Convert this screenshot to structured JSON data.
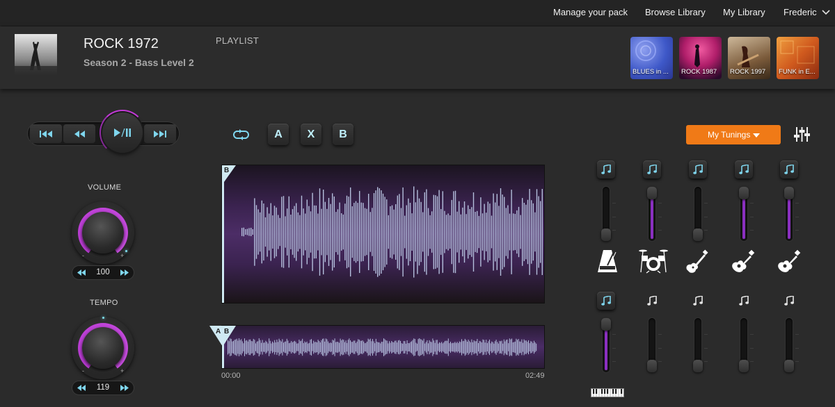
{
  "nav": {
    "manage_pack": "Manage your pack",
    "browse_library": "Browse Library",
    "my_library": "My Library",
    "user": "Frederic"
  },
  "track": {
    "title": "ROCK 1972",
    "subtitle": "Season 2 - Bass Level 2"
  },
  "playlist": {
    "label": "PLAYLIST",
    "items": [
      {
        "label": "BLUES in ...",
        "color": "#3e58c8"
      },
      {
        "label": "ROCK 1987",
        "color": "#b01e6a"
      },
      {
        "label": "ROCK 1997",
        "color": "#7a5a3a"
      },
      {
        "label": "FUNK in E...",
        "color": "#d05a1e"
      }
    ]
  },
  "transport": {
    "buttons": [
      "skip-back-icon",
      "rewind-icon",
      "play-pause-icon",
      "skip-forward-icon"
    ]
  },
  "volume": {
    "label": "VOLUME",
    "value": "100",
    "minus": "-",
    "plus": "+"
  },
  "tempo": {
    "label": "TEMPO",
    "value": "119",
    "minus": "-",
    "plus": "+"
  },
  "loop_controls": {
    "a": "A",
    "x": "X",
    "b": "B"
  },
  "waveform": {
    "main_marker": "B",
    "mini_marker_a": "A",
    "mini_marker_b": "B",
    "start_time": "00:00",
    "end_time": "02:49"
  },
  "tunings": {
    "label": "My Tunings"
  },
  "mixer": {
    "accent_color": "#8a2fc0",
    "icon_color": "#7fd6ee",
    "top_row": [
      {
        "instrument": "metronome-icon",
        "level": 0.0,
        "active": true
      },
      {
        "instrument": "drums-icon",
        "level": 1.0,
        "active": true
      },
      {
        "instrument": "bass-guitar-icon",
        "level": 0.0,
        "active": true
      },
      {
        "instrument": "acoustic-guitar-icon",
        "level": 1.0,
        "active": true
      },
      {
        "instrument": "acoustic-guitar-icon",
        "level": 1.0,
        "active": true
      }
    ],
    "bottom_row": [
      {
        "instrument": "keyboard-icon",
        "level": 1.0,
        "active": true
      },
      {
        "level": 0.0,
        "active": false
      },
      {
        "level": 0.0,
        "active": false
      },
      {
        "level": 0.0,
        "active": false
      },
      {
        "level": 0.0,
        "active": false
      }
    ]
  }
}
